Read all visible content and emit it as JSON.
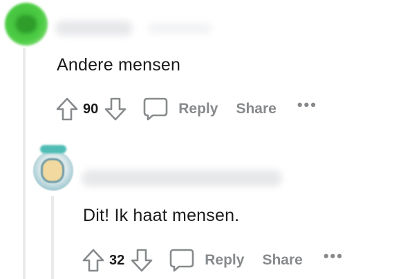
{
  "comments": [
    {
      "text": "Andere mensen",
      "votes": "90",
      "reply_label": "Reply",
      "share_label": "Share",
      "more_label": "•••"
    },
    {
      "text": "Dit! Ik haat mensen.",
      "votes": "32",
      "reply_label": "Reply",
      "share_label": "Share",
      "more_label": "•••"
    }
  ],
  "icons": {
    "upvote": "arrow-up-outline",
    "downvote": "arrow-down-outline",
    "reply": "speech-bubble-outline",
    "more": "horizontal-ellipsis"
  },
  "colors": {
    "text": "#1a1a1b",
    "muted": "#878a8c",
    "thread_line": "#e9eaeb"
  }
}
